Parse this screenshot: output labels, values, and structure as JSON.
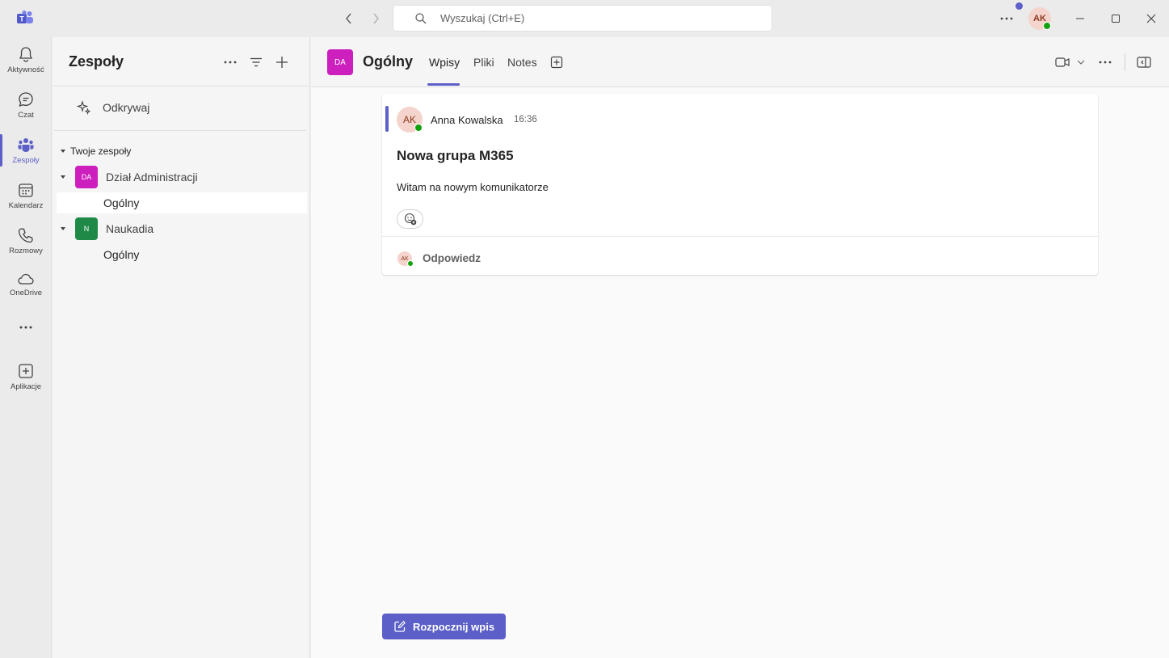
{
  "titlebar": {
    "search_placeholder": "Wyszukaj (Ctrl+E)",
    "avatar_initials": "AK"
  },
  "rail": {
    "items": [
      {
        "label": "Aktywność",
        "icon": "bell-icon"
      },
      {
        "label": "Czat",
        "icon": "chat-icon"
      },
      {
        "label": "Zespoły",
        "icon": "teams-icon",
        "active": true
      },
      {
        "label": "Kalendarz",
        "icon": "calendar-icon"
      },
      {
        "label": "Rozmowy",
        "icon": "phone-icon"
      },
      {
        "label": "OneDrive",
        "icon": "cloud-icon"
      },
      {
        "label": "",
        "icon": "more-icon"
      },
      {
        "label": "Aplikacje",
        "icon": "add-app-icon"
      }
    ]
  },
  "panel": {
    "title": "Zespoły",
    "discover_label": "Odkrywaj",
    "section_label": "Twoje zespoły",
    "teams": [
      {
        "initials": "DA",
        "name": "Dział Administracji",
        "color": "#cc1fbe",
        "channels": [
          "Ogólny"
        ]
      },
      {
        "initials": "N",
        "name": "Naukadia",
        "color": "#1f8a47",
        "channels": [
          "Ogólny"
        ]
      }
    ]
  },
  "header": {
    "channel_initials": "DA",
    "channel_title": "Ogólny",
    "tabs": [
      "Wpisy",
      "Pliki",
      "Notes"
    ],
    "active_tab": "Wpisy"
  },
  "post": {
    "author_initials": "AK",
    "author": "Anna Kowalska",
    "time": "16:36",
    "subject": "Nowa grupa M365",
    "body": "Witam na nowym komunikatorze",
    "reply_initials": "AK",
    "reply_label": "Odpowiedz"
  },
  "compose": {
    "start_post_label": "Rozpocznij wpis"
  },
  "colors": {
    "accent": "#5b5fc7",
    "presence": "#13a10e"
  }
}
